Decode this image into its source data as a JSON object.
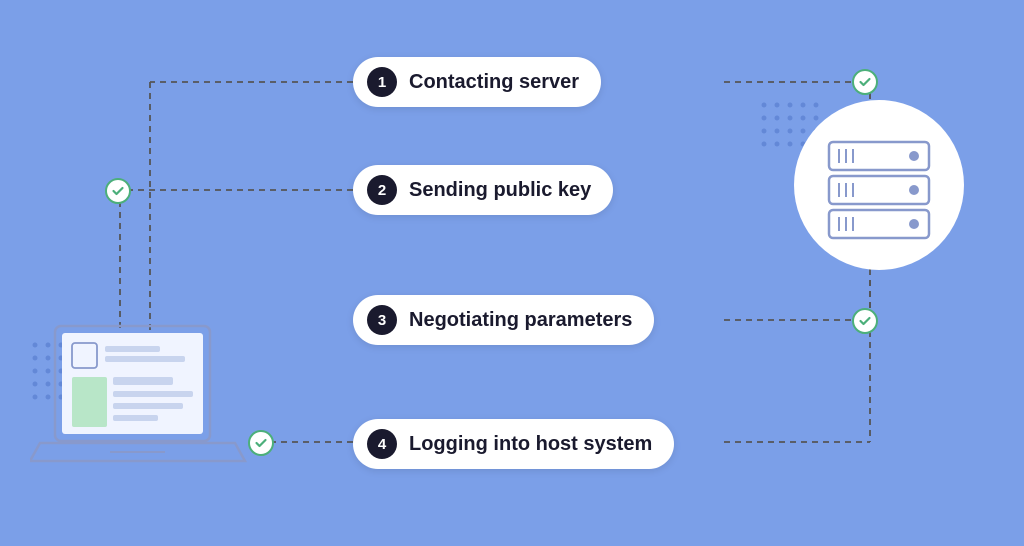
{
  "background_color": "#7B9FE8",
  "accent_green": "#4CAF7A",
  "dark": "#1a1a2e",
  "steps": [
    {
      "number": "1",
      "label": "Contacting server"
    },
    {
      "number": "2",
      "label": "Sending public key"
    },
    {
      "number": "3",
      "label": "Negotiating parameters"
    },
    {
      "number": "4",
      "label": "Logging into host system"
    }
  ]
}
